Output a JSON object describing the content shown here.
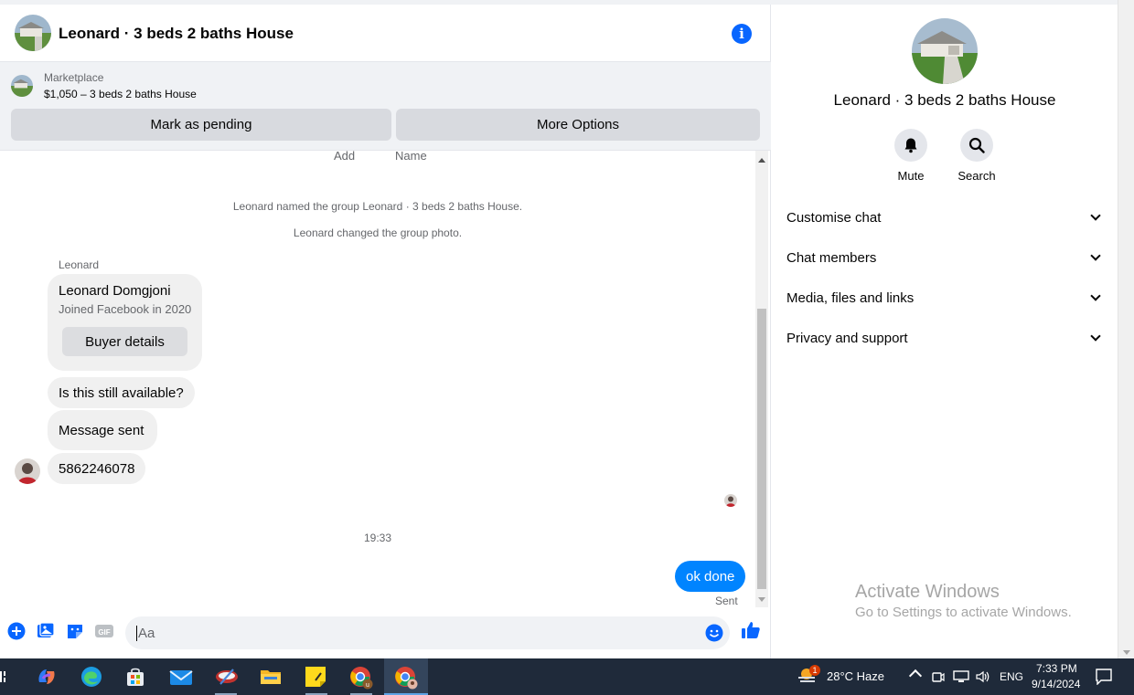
{
  "chat": {
    "title": "Leonard · 3 beds 2 baths House",
    "info_icon": "info-icon",
    "marketplace": {
      "label": "Marketplace",
      "listing": "$1,050 – 3 beds 2 baths House",
      "mark_pending": "Mark as pending",
      "more_options": "More Options"
    },
    "cut_off": [
      "Add",
      "Name"
    ],
    "system_messages": [
      "Leonard named the group Leonard · 3 beds 2 baths House.",
      "Leonard changed the group photo."
    ],
    "sender_name": "Leonard",
    "profile_card": {
      "name": "Leonard Domgjoni",
      "joined": "Joined Facebook in 2020",
      "button": "Buyer details"
    },
    "incoming": [
      "Is this still available?",
      "Message sent",
      "5862246078"
    ],
    "timestamp": "19:33",
    "outgoing": "ok done",
    "outgoing_status": "Sent",
    "composer_placeholder": "Aa",
    "composer_icons": [
      "plus-icon",
      "photo-icon",
      "sticker-icon",
      "gif-icon",
      "emoji-icon",
      "thumbs-up-icon"
    ]
  },
  "side": {
    "title": "Leonard · 3 beds 2 baths House",
    "actions": [
      {
        "label": "Mute",
        "icon": "bell-icon"
      },
      {
        "label": "Search",
        "icon": "search-icon"
      }
    ],
    "sections": [
      "Customise chat",
      "Chat members",
      "Media, files and links",
      "Privacy and support"
    ]
  },
  "watermark": {
    "line1": "Activate Windows",
    "line2": "Go to Settings to activate Windows."
  },
  "taskbar": {
    "weather_badge": "1",
    "weather": "28°C  Haze",
    "language": "ENG",
    "time": "7:33 PM",
    "date": "9/14/2024"
  },
  "colors": {
    "accent": "#0866ff",
    "outgoing_bubble": "#0084ff",
    "taskbar": "#1f2a3a"
  }
}
